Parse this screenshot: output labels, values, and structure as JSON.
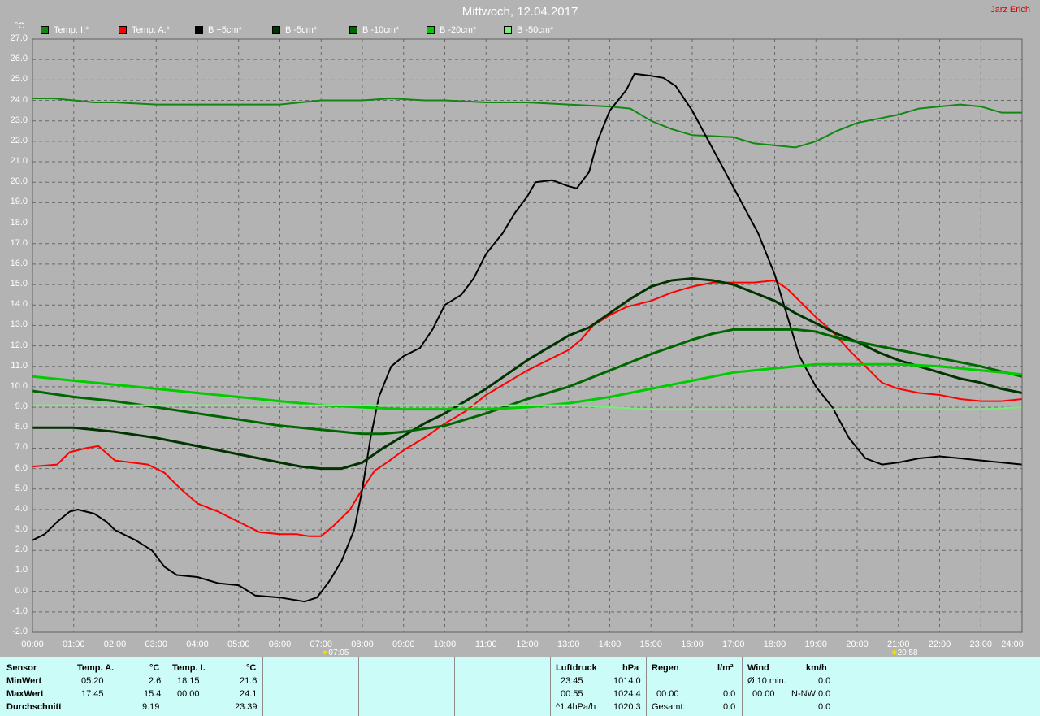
{
  "header": {
    "title": "Mittwoch, 12.04.2017",
    "author": "Jarz Erich",
    "unit": "°C"
  },
  "legend": [
    {
      "label": "Temp. I.*",
      "color": "#118811"
    },
    {
      "label": "Temp. A.*",
      "color": "#ff0000"
    },
    {
      "label": "B +5cm*",
      "color": "#000000"
    },
    {
      "label": "B -5cm*",
      "color": "#003300"
    },
    {
      "label": "B -10cm*",
      "color": "#006600"
    },
    {
      "label": "B -20cm*",
      "color": "#00cc00"
    },
    {
      "label": "B -50cm*",
      "color": "#77ee77"
    }
  ],
  "chart_data": {
    "type": "line",
    "title": "Mittwoch, 12.04.2017",
    "ylabel": "°C",
    "xlim": [
      0,
      24
    ],
    "ylim": [
      -2,
      27
    ],
    "grid": true,
    "x_ticks": [
      "00:00",
      "01:00",
      "02:00",
      "03:00",
      "04:00",
      "05:00",
      "06:00",
      "07:00",
      "08:00",
      "09:00",
      "10:00",
      "11:00",
      "12:00",
      "13:00",
      "14:00",
      "15:00",
      "16:00",
      "17:00",
      "18:00",
      "19:00",
      "20:00",
      "21:00",
      "22:00",
      "23:00",
      "24:00"
    ],
    "y_ticks": [
      "-2.0",
      "-1.0",
      "0.0",
      "1.0",
      "2.0",
      "3.0",
      "4.0",
      "5.0",
      "6.0",
      "7.0",
      "8.0",
      "9.0",
      "10.0",
      "11.0",
      "12.0",
      "13.0",
      "14.0",
      "15.0",
      "16.0",
      "17.0",
      "18.0",
      "19.0",
      "20.0",
      "21.0",
      "22.0",
      "23.0",
      "24.0",
      "25.0",
      "26.0",
      "27.0"
    ],
    "sunrise": "07:05",
    "sunset": "20:58",
    "series": [
      {
        "name": "Temp. I.*",
        "color": "#118811",
        "width": 2,
        "points": [
          [
            0,
            24.1
          ],
          [
            0.5,
            24.1
          ],
          [
            1,
            24.0
          ],
          [
            1.5,
            23.9
          ],
          [
            2,
            23.9
          ],
          [
            3,
            23.8
          ],
          [
            4,
            23.8
          ],
          [
            5,
            23.8
          ],
          [
            6,
            23.8
          ],
          [
            6.5,
            23.9
          ],
          [
            7,
            24.0
          ],
          [
            8,
            24.0
          ],
          [
            8.7,
            24.1
          ],
          [
            9.5,
            24.0
          ],
          [
            10,
            24.0
          ],
          [
            11,
            23.9
          ],
          [
            12,
            23.9
          ],
          [
            13,
            23.8
          ],
          [
            14,
            23.7
          ],
          [
            14.5,
            23.6
          ],
          [
            15,
            23.0
          ],
          [
            15.5,
            22.6
          ],
          [
            16,
            22.3
          ],
          [
            17,
            22.2
          ],
          [
            17.5,
            21.9
          ],
          [
            18,
            21.8
          ],
          [
            18.5,
            21.7
          ],
          [
            19,
            22.0
          ],
          [
            19.5,
            22.5
          ],
          [
            20,
            22.9
          ],
          [
            20.5,
            23.1
          ],
          [
            21,
            23.3
          ],
          [
            21.5,
            23.6
          ],
          [
            22,
            23.7
          ],
          [
            22.5,
            23.8
          ],
          [
            23,
            23.7
          ],
          [
            23.5,
            23.4
          ],
          [
            24,
            23.4
          ]
        ]
      },
      {
        "name": "Temp. A.*",
        "color": "#ff0000",
        "width": 2,
        "points": [
          [
            0,
            6.1
          ],
          [
            0.6,
            6.2
          ],
          [
            0.9,
            6.8
          ],
          [
            1.3,
            7.0
          ],
          [
            1.6,
            7.1
          ],
          [
            2,
            6.4
          ],
          [
            2.4,
            6.3
          ],
          [
            2.8,
            6.2
          ],
          [
            3.2,
            5.8
          ],
          [
            3.6,
            5.0
          ],
          [
            4,
            4.3
          ],
          [
            4.5,
            3.9
          ],
          [
            5,
            3.4
          ],
          [
            5.5,
            2.9
          ],
          [
            6,
            2.8
          ],
          [
            6.4,
            2.8
          ],
          [
            6.7,
            2.7
          ],
          [
            7,
            2.7
          ],
          [
            7.3,
            3.2
          ],
          [
            7.7,
            4.0
          ],
          [
            8,
            5.0
          ],
          [
            8.3,
            5.9
          ],
          [
            8.6,
            6.3
          ],
          [
            9,
            6.9
          ],
          [
            9.5,
            7.5
          ],
          [
            10,
            8.2
          ],
          [
            10.5,
            8.8
          ],
          [
            11,
            9.6
          ],
          [
            11.5,
            10.2
          ],
          [
            12,
            10.8
          ],
          [
            12.5,
            11.3
          ],
          [
            13,
            11.8
          ],
          [
            13.3,
            12.3
          ],
          [
            13.6,
            13.0
          ],
          [
            14,
            13.5
          ],
          [
            14.4,
            13.9
          ],
          [
            15,
            14.2
          ],
          [
            15.5,
            14.6
          ],
          [
            16,
            14.9
          ],
          [
            16.5,
            15.1
          ],
          [
            17,
            15.1
          ],
          [
            17.5,
            15.1
          ],
          [
            18,
            15.2
          ],
          [
            18.3,
            14.8
          ],
          [
            18.6,
            14.2
          ],
          [
            19,
            13.4
          ],
          [
            19.4,
            12.7
          ],
          [
            19.8,
            11.8
          ],
          [
            20.2,
            11.0
          ],
          [
            20.6,
            10.2
          ],
          [
            21,
            9.9
          ],
          [
            21.5,
            9.7
          ],
          [
            22,
            9.6
          ],
          [
            22.5,
            9.4
          ],
          [
            23,
            9.3
          ],
          [
            23.5,
            9.3
          ],
          [
            24,
            9.4
          ]
        ]
      },
      {
        "name": "B +5cm*",
        "color": "#000000",
        "width": 2,
        "points": [
          [
            0,
            2.5
          ],
          [
            0.3,
            2.8
          ],
          [
            0.6,
            3.4
          ],
          [
            0.9,
            3.9
          ],
          [
            1.1,
            4.0
          ],
          [
            1.5,
            3.8
          ],
          [
            1.8,
            3.4
          ],
          [
            2,
            3.0
          ],
          [
            2.5,
            2.5
          ],
          [
            2.9,
            2.0
          ],
          [
            3.2,
            1.2
          ],
          [
            3.5,
            0.8
          ],
          [
            4,
            0.7
          ],
          [
            4.5,
            0.4
          ],
          [
            5,
            0.3
          ],
          [
            5.4,
            -0.2
          ],
          [
            6,
            -0.3
          ],
          [
            6.3,
            -0.4
          ],
          [
            6.6,
            -0.5
          ],
          [
            6.9,
            -0.3
          ],
          [
            7.2,
            0.5
          ],
          [
            7.5,
            1.5
          ],
          [
            7.8,
            3.0
          ],
          [
            8.0,
            5.0
          ],
          [
            8.2,
            7.5
          ],
          [
            8.4,
            9.5
          ],
          [
            8.7,
            11.0
          ],
          [
            9.0,
            11.5
          ],
          [
            9.4,
            11.9
          ],
          [
            9.7,
            12.8
          ],
          [
            10.0,
            14.0
          ],
          [
            10.4,
            14.5
          ],
          [
            10.7,
            15.3
          ],
          [
            11.0,
            16.5
          ],
          [
            11.4,
            17.5
          ],
          [
            11.7,
            18.5
          ],
          [
            12.0,
            19.3
          ],
          [
            12.2,
            20.0
          ],
          [
            12.6,
            20.1
          ],
          [
            13.0,
            19.8
          ],
          [
            13.2,
            19.7
          ],
          [
            13.5,
            20.5
          ],
          [
            13.7,
            22.0
          ],
          [
            14.0,
            23.5
          ],
          [
            14.4,
            24.5
          ],
          [
            14.6,
            25.3
          ],
          [
            15.0,
            25.2
          ],
          [
            15.3,
            25.1
          ],
          [
            15.6,
            24.7
          ],
          [
            16.0,
            23.5
          ],
          [
            16.4,
            22.0
          ],
          [
            16.8,
            20.5
          ],
          [
            17.2,
            19.0
          ],
          [
            17.6,
            17.5
          ],
          [
            18.0,
            15.5
          ],
          [
            18.3,
            13.5
          ],
          [
            18.6,
            11.5
          ],
          [
            19.0,
            10.0
          ],
          [
            19.4,
            9.0
          ],
          [
            19.8,
            7.5
          ],
          [
            20.2,
            6.5
          ],
          [
            20.6,
            6.2
          ],
          [
            21.0,
            6.3
          ],
          [
            21.5,
            6.5
          ],
          [
            22.0,
            6.6
          ],
          [
            22.5,
            6.5
          ],
          [
            23.0,
            6.4
          ],
          [
            23.5,
            6.3
          ],
          [
            24.0,
            6.2
          ]
        ]
      },
      {
        "name": "B -5cm*",
        "color": "#003300",
        "width": 3,
        "points": [
          [
            0,
            8.0
          ],
          [
            0.5,
            8.0
          ],
          [
            1,
            8.0
          ],
          [
            1.5,
            7.9
          ],
          [
            2,
            7.8
          ],
          [
            3,
            7.5
          ],
          [
            4,
            7.1
          ],
          [
            5,
            6.7
          ],
          [
            6,
            6.3
          ],
          [
            6.5,
            6.1
          ],
          [
            7,
            6.0
          ],
          [
            7.5,
            6.0
          ],
          [
            8,
            6.3
          ],
          [
            8.5,
            7.0
          ],
          [
            9,
            7.6
          ],
          [
            9.5,
            8.2
          ],
          [
            10,
            8.7
          ],
          [
            10.5,
            9.3
          ],
          [
            11,
            9.9
          ],
          [
            11.5,
            10.6
          ],
          [
            12,
            11.3
          ],
          [
            12.5,
            11.9
          ],
          [
            13,
            12.5
          ],
          [
            13.5,
            12.9
          ],
          [
            14,
            13.6
          ],
          [
            14.5,
            14.3
          ],
          [
            15,
            14.9
          ],
          [
            15.5,
            15.2
          ],
          [
            16,
            15.3
          ],
          [
            16.5,
            15.2
          ],
          [
            17,
            15.0
          ],
          [
            17.5,
            14.6
          ],
          [
            18,
            14.2
          ],
          [
            18.5,
            13.6
          ],
          [
            19,
            13.1
          ],
          [
            19.5,
            12.6
          ],
          [
            20,
            12.2
          ],
          [
            20.5,
            11.7
          ],
          [
            21,
            11.3
          ],
          [
            21.5,
            11.0
          ],
          [
            22,
            10.7
          ],
          [
            22.5,
            10.4
          ],
          [
            23,
            10.2
          ],
          [
            23.5,
            9.9
          ],
          [
            24,
            9.7
          ]
        ]
      },
      {
        "name": "B -10cm*",
        "color": "#006600",
        "width": 3,
        "points": [
          [
            0,
            9.8
          ],
          [
            1,
            9.5
          ],
          [
            2,
            9.3
          ],
          [
            3,
            9.0
          ],
          [
            4,
            8.7
          ],
          [
            5,
            8.4
          ],
          [
            6,
            8.1
          ],
          [
            7,
            7.9
          ],
          [
            7.5,
            7.8
          ],
          [
            8,
            7.7
          ],
          [
            8.5,
            7.7
          ],
          [
            9,
            7.8
          ],
          [
            10,
            8.1
          ],
          [
            11,
            8.7
          ],
          [
            12,
            9.4
          ],
          [
            13,
            10.0
          ],
          [
            14,
            10.8
          ],
          [
            15,
            11.6
          ],
          [
            16,
            12.3
          ],
          [
            16.5,
            12.6
          ],
          [
            17,
            12.8
          ],
          [
            18,
            12.8
          ],
          [
            18.5,
            12.8
          ],
          [
            19,
            12.7
          ],
          [
            19.5,
            12.4
          ],
          [
            20,
            12.2
          ],
          [
            21,
            11.8
          ],
          [
            22,
            11.4
          ],
          [
            23,
            11.0
          ],
          [
            24,
            10.5
          ]
        ]
      },
      {
        "name": "B -20cm*",
        "color": "#00cc00",
        "width": 3,
        "points": [
          [
            0,
            10.5
          ],
          [
            1,
            10.3
          ],
          [
            2,
            10.1
          ],
          [
            3,
            9.9
          ],
          [
            4,
            9.7
          ],
          [
            5,
            9.5
          ],
          [
            6,
            9.3
          ],
          [
            7,
            9.1
          ],
          [
            8,
            9.0
          ],
          [
            9,
            8.9
          ],
          [
            10,
            8.9
          ],
          [
            11,
            8.9
          ],
          [
            12,
            9.0
          ],
          [
            13,
            9.2
          ],
          [
            14,
            9.5
          ],
          [
            15,
            9.9
          ],
          [
            16,
            10.3
          ],
          [
            17,
            10.7
          ],
          [
            18,
            10.9
          ],
          [
            19,
            11.1
          ],
          [
            20,
            11.1
          ],
          [
            21,
            11.1
          ],
          [
            22,
            11.0
          ],
          [
            23,
            10.8
          ],
          [
            24,
            10.6
          ]
        ]
      },
      {
        "name": "B -50cm*",
        "color": "#77ee77",
        "width": 2,
        "points": [
          [
            0,
            9.1
          ],
          [
            2,
            9.1
          ],
          [
            4,
            9.1
          ],
          [
            6,
            9.1
          ],
          [
            8,
            9.1
          ],
          [
            10,
            9.1
          ],
          [
            12,
            9.1
          ],
          [
            13,
            9.1
          ],
          [
            14,
            9.0
          ],
          [
            15,
            8.9
          ],
          [
            16,
            8.9
          ],
          [
            18,
            8.9
          ],
          [
            20,
            8.9
          ],
          [
            22,
            8.9
          ],
          [
            23,
            8.9
          ],
          [
            24,
            9.0
          ]
        ]
      }
    ]
  },
  "summary": {
    "rows": [
      "Sensor",
      "MinWert",
      "MaxWert",
      "Durchschnitt"
    ],
    "temp_a": {
      "title": "Temp. A.",
      "unit": "°C",
      "min_time": "05:20",
      "min_val": "2.6",
      "max_time": "17:45",
      "max_val": "15.4",
      "avg_val": "9.19"
    },
    "temp_i": {
      "title": "Temp. I.",
      "unit": "°C",
      "min_time": "18:15",
      "min_val": "21.6",
      "max_time": "00:00",
      "max_val": "24.1",
      "avg_val": "23.39"
    },
    "luftdruck": {
      "title": "Luftdruck",
      "unit": "hPa",
      "min_time": "23:45",
      "min_val": "1014.0",
      "max_time": "00:55",
      "max_val": "1024.4",
      "trend": "^1.4hPa/h",
      "avg_val": "1020.3"
    },
    "regen": {
      "title": "Regen",
      "unit": "l/m²",
      "max_time": "00:00",
      "max_val": "0.0",
      "min_val": "0.0",
      "total_label": "Gesamt:",
      "total_val": "0.0"
    },
    "wind": {
      "title": "Wind",
      "unit": "km/h",
      "min_label": "Ø 10 min.",
      "min_val": "0.0",
      "max_time": "00:00",
      "max_dir": "N-NW",
      "max_val": "0.0",
      "avg_val": "0.0"
    }
  }
}
